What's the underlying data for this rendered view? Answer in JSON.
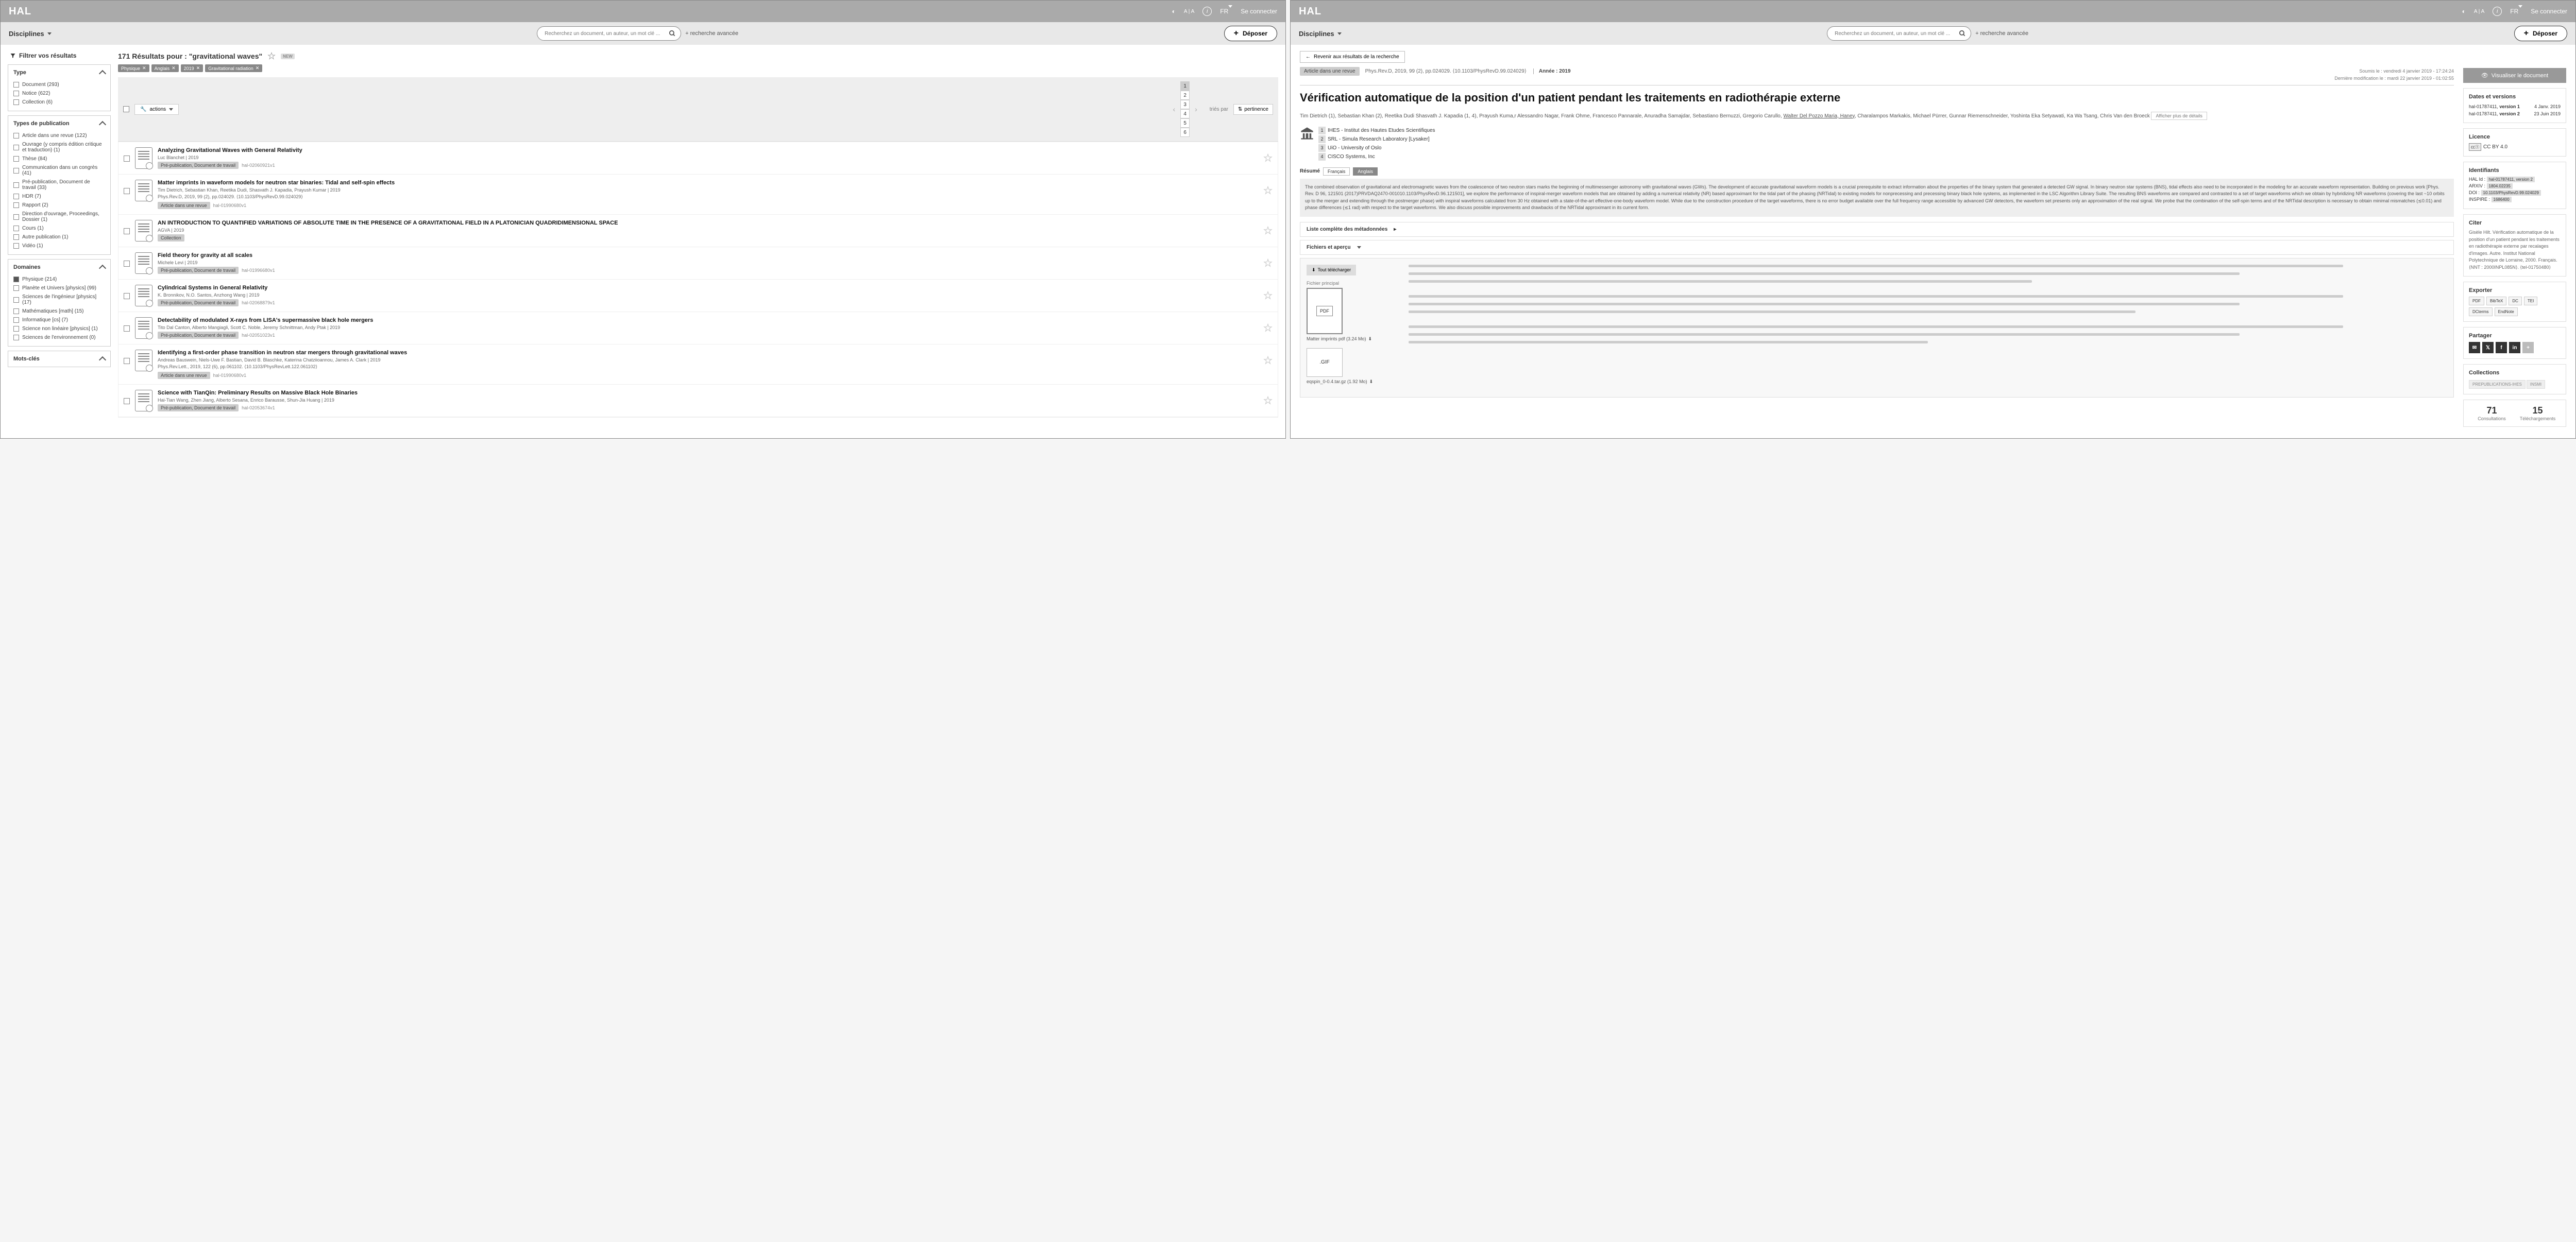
{
  "topbar": {
    "logo": "HAL",
    "lang": "FR",
    "login": "Se connecter",
    "text_size": "A | A"
  },
  "subbar": {
    "disciplines": "Disciplines",
    "search_placeholder": "Recherchez un document, un auteur, un mot clé ...",
    "advanced": "+ recherche avancée",
    "deposit": "Déposer"
  },
  "s1": {
    "filter_title": "Filtrer vos résultats",
    "results_heading": "171 Résultats pour : \"gravitational waves\"",
    "new_badge": "NEW",
    "chips": [
      "Physique",
      "Anglais",
      "2019",
      "Gravitational radiation"
    ],
    "actions": "actions",
    "sort_label": "triés par",
    "sort_value": "pertinence",
    "pages": [
      "1",
      "2",
      "3",
      "4",
      "5",
      "6"
    ],
    "facets": {
      "type": {
        "label": "Type",
        "items": [
          "Document (293)",
          "Notice (622)",
          "Collection (6)"
        ]
      },
      "pub": {
        "label": "Types de publication",
        "items": [
          "Article dans une revue (122)",
          "Ouvrage (y compris édition critique et traduction) (1)",
          "Thèse (84)",
          "Communication dans un congrès (41)",
          "Pré-publication, Document de travail (33)",
          "HDR (7)",
          "Rapport (2)",
          "Direction d'ouvrage, Proceedings, Dossier (1)",
          "Cours (1)",
          "Autre publication (1)",
          "Vidéo (1)"
        ]
      },
      "dom": {
        "label": "Domaines",
        "items": [
          "Physique (214)",
          "Planète et Univers [physics] (99)",
          "Sciences de l'ingénieur [physics] (17)",
          "Mathématiques [math] (15)",
          "Informatique [cs] (7)",
          "Science non linéaire [physics] (1)",
          "Sciences de l'environnement (0)"
        ],
        "checked": 0
      },
      "kw": {
        "label": "Mots-clés"
      }
    },
    "results": [
      {
        "title": "Analyzing Gravitational Waves with General Relativity",
        "authors": "Luc Blanchet",
        "ref": "2019",
        "tag": "Pré-publication, Document de travail",
        "id": "hal-02060921v1"
      },
      {
        "title": "Matter imprints in waveform models for neutron star binaries: Tidal and self-spin effects",
        "authors": "Tim Dietrich, Sebastian Khan, Reetika Dudi, Shasvath J. Kapadia, Prayush Kumar",
        "ref": "Phys.Rev.D, 2019, 99 (2), pp.024029.  ⟨10.1103/PhysRevD.99.024029⟩",
        "year": "2019",
        "tag": "Article dans une revue",
        "id": "hal-01990680v1"
      },
      {
        "title": "AN INTRODUCTION TO QUANTIFIED VARIATIONS OF ABSOLUTE TIME IN THE PRESENCE OF A GRAVITATIONAL FIELD IN A PLATONICIAN QUADRIDIMENSIONAL SPACE",
        "authors": "AGVA",
        "ref": "2019",
        "tag": "Collection",
        "id": ""
      },
      {
        "title": "Field theory for gravity at all scales",
        "authors": "Michele Levi",
        "ref": "2019",
        "tag": "Pré-publication, Document de travail",
        "id": "hal-01996680v1"
      },
      {
        "title": "Cylindrical Systems in General Relativity",
        "authors": "K. Bronnikov, N.O. Santos, Anzhong Wang",
        "ref": "2019",
        "tag": "Pré-publication, Document de travail",
        "id": "hal-02068879v1"
      },
      {
        "title": "Detectability of modulated X-rays from LISA's supermassive black hole mergers",
        "authors": "Tito Dal Canton, Alberto Mangiagli, Scott C. Noble, Jeremy Schnittman, Andy Ptak",
        "ref": "2019",
        "tag": "Pré-publication, Document de travail",
        "id": "hal-02051023v1"
      },
      {
        "title": "Identifying a first-order phase transition in neutron star mergers through gravitational waves",
        "authors": "Andreas Bauswein, Niels-Uwe F. Bastian, David B. Blaschke, Katerina Chatziioannou, James A. Clark",
        "ref": "Phys.Rev.Lett., 2019, 122 (6), pp.061102.  ⟨10.1103/PhysRevLett.122.061102⟩",
        "year": "2019",
        "tag": "Article dans une revue",
        "id": "hal-01990680v1"
      },
      {
        "title": "Science with TianQin: Preliminary Results on Massive Black Hole Binaries",
        "authors": "Hai-Tian Wang, Zhen Jiang, Alberto Sesana, Enrico Barausse, Shun-Jia Huang",
        "ref": "2019",
        "tag": "Pré-publication, Document de travail",
        "id": "hal-02053674v1"
      }
    ]
  },
  "s2": {
    "back": "Revenir aux résultats de la recherche",
    "doc_type": "Article dans une revue",
    "doc_ref": "Phys.Rev.D, 2019, 99 (2), pp.024029.  ⟨10.1103/PhysRevD.99.024029⟩",
    "year": "Année : 2019",
    "submitted": "Soumis le : vendredi 4 janvier 2019 - 17:24:24",
    "modified": "Dernière modification le : mardi 22 janvier 2019 - 01:02:55",
    "title": "Vérification automatique de la position d'un patient pendant les traitements en radiothérapie externe",
    "authors_html": "Tim Dietrich (1), Sebastian Khan (2), Reetika Dudi Shasvath J. Kapadia (1, 4), Prayush Kuma,r Alessandro Nagar, Frank Ohme, Francesco Pannarale,  Anuradha Samajdar, Sebastiano Bernuzzi, Gregorio Carullo, <span class='auth-link'>Walter Del Pozzo Maria, Haney</span>, Charalampos Markakis, Michael Pürrer, Gunnar Riemenschneider, Yoshinta Eka Setyawati, Ka Wa Tsang, Chris Van den Broeck",
    "details_btn": "Afficher plus de détails",
    "affiliations": [
      "IHES - Institut des Hautes Etudes Scientifiques",
      "SRL - Simula Research Laboratory [Lysaker]",
      "UiO - University of Oslo",
      "CISCO Systems, Inc"
    ],
    "resume": "Résumé",
    "lang_fr": "Français",
    "lang_en": "Anglais",
    "abstract": "The combined observation of gravitational and electromagnetic waves from the coalescence of two neutron stars marks the beginning of multimessenger astronomy with gravitational waves (GWs). The development of accurate gravitational waveform models is a crucial prerequisite to extract information about the properties of the binary system that generated a detected GW signal. In binary neutron star systems (BNS), tidal effects also need to be incorporated in the modeling for an accurate waveform representation. Building on previous work [Phys. Rev. D 96, 121501 (2017)PRVDAQ2470-001010.1103/PhysRevD.96.121501], we explore the performance of inspiral-merger waveform models that are obtained by adding a numerical relativity (NR) based approximant for the tidal part of the phasing (NRTidal) to existing models for nonprecessing and precessing binary black hole systems, as implemented in the LSC Algorithm Library Suite. The resulting BNS waveforms are compared and contrasted to a set of target waveforms which we obtain by hybridizing NR waveforms (covering the last ~10 orbits up to the merger and extending through the postmerger phase) with inspiral waveforms calculated from 30 Hz obtained with a state-of-the-art effective-one-body waveform model. While due to the construction procedure of the target waveforms, there is no error budget available over the full frequency range accessible by advanced GW detectors, the waveform set presents only an approximation of the real signal. We probe that the combination of the self-spin terms and of the NRTidal description is necessary to obtain minimal mismatches (≲0.01) and phase differences (≲1 rad) with respect to the target waveforms. We also discuss possible improvements and drawbacks of the NRTidal approximant in its current form.",
    "meta_acc": "Liste complète des métadonnées",
    "files_acc": "Fichiers et aperçu",
    "download_all": "Tout télécharger",
    "main_file_lbl": "Fichier principal",
    "pdf_name": "Matter imprints pdf (3.24 Mo)",
    "gif_name": "eqspin_0-0.4.tar.gz (1.92 Mo)",
    "side": {
      "view": "Visualiser le document",
      "dates_h": "Dates et versions",
      "versions": [
        {
          "id": "hal-01787411",
          "v": "version 1",
          "d": "4 Janv. 2019"
        },
        {
          "id": "hal-01787411",
          "v": "version 2",
          "d": "23 Juin 2019"
        }
      ],
      "lic_h": "Licence",
      "lic": "CC BY 4.0",
      "id_h": "Identifiants",
      "ids": {
        "hal": "hal-01787411, version 2",
        "arxiv": "1804.02235",
        "doi": "10.1103/PhysRevD.99.024029",
        "inspire": "1686400"
      },
      "cite_h": "Citer",
      "cite": "Gisèle Hilt. Vérification automatique de la position d'un patient pendant les traitements en radiothérapie externe par recalages d'images. Autre. Institut National Polytechnique de Lorraine, 2000. Français. ⟨NNT : 2000INPL085N⟩. ⟨tel-01750480⟩",
      "exp_h": "Exporter",
      "exports": [
        "PDF",
        "BibTeX",
        "DC",
        "TEI",
        "DCterms",
        "EndNote"
      ],
      "share_h": "Partager",
      "coll_h": "Collections",
      "colls": [
        "PREPUBLICATIONS-IHES",
        "INSMI"
      ],
      "stats": [
        {
          "n": "71",
          "l": "Consultations"
        },
        {
          "n": "15",
          "l": "Téléchargements"
        }
      ]
    }
  }
}
